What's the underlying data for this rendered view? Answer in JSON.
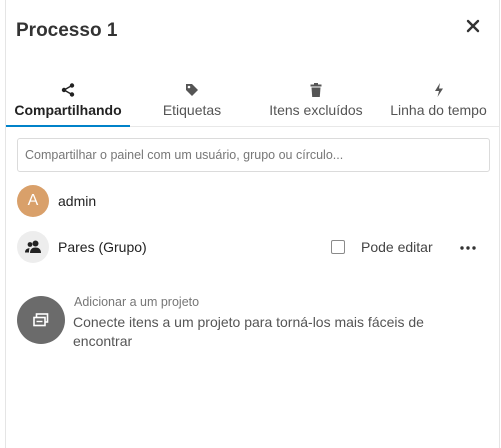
{
  "header": {
    "title": "Processo 1"
  },
  "tabs": [
    {
      "label": "Compartilhando",
      "icon": "share-icon"
    },
    {
      "label": "Etiquetas",
      "icon": "tag-icon"
    },
    {
      "label": "Itens excluídos",
      "icon": "trash-icon"
    },
    {
      "label": "Linha do tempo",
      "icon": "lightning-icon"
    }
  ],
  "sharing": {
    "placeholder": "Compartilhar o painel com um usuário, grupo ou círculo...",
    "owner": {
      "initial": "A",
      "name": "admin",
      "avatar_color": "#d9a06a"
    },
    "group": {
      "name": "Pares (Grupo)",
      "can_edit_label": "Pode editar",
      "can_edit": false
    }
  },
  "project": {
    "title": "Adicionar a um projeto",
    "description": "Conecte itens a um projeto para torná-los mais fáceis de encontrar"
  },
  "colors": {
    "accent": "#0082c9"
  }
}
